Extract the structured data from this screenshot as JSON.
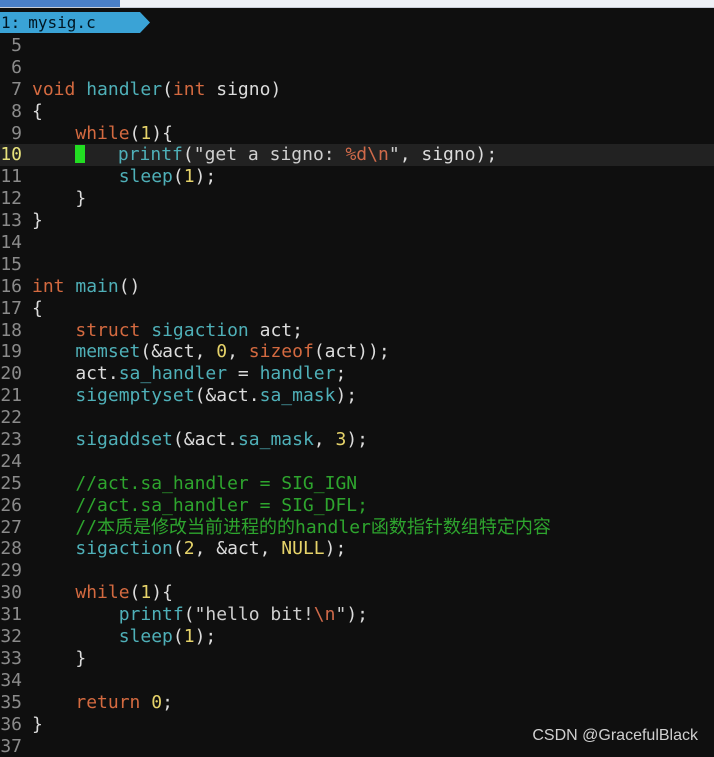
{
  "window": {
    "tab_label": "",
    "tab_close": "×"
  },
  "buffer": {
    "number": "1:",
    "filename": "mysig.c"
  },
  "lines": [
    {
      "n": "5",
      "code": ""
    },
    {
      "n": "6",
      "code": ""
    },
    {
      "n": "7",
      "code": "void handler(int signo)"
    },
    {
      "n": "8",
      "code": "{"
    },
    {
      "n": "9",
      "code": "    while(1){"
    },
    {
      "n": "10",
      "code": "        printf(\"get a signo: %d\\n\", signo);"
    },
    {
      "n": "11",
      "code": "        sleep(1);"
    },
    {
      "n": "12",
      "code": "    }"
    },
    {
      "n": "13",
      "code": "}"
    },
    {
      "n": "14",
      "code": ""
    },
    {
      "n": "15",
      "code": ""
    },
    {
      "n": "16",
      "code": "int main()"
    },
    {
      "n": "17",
      "code": "{"
    },
    {
      "n": "18",
      "code": "    struct sigaction act;"
    },
    {
      "n": "19",
      "code": "    memset(&act, 0, sizeof(act));"
    },
    {
      "n": "20",
      "code": "    act.sa_handler = handler;"
    },
    {
      "n": "21",
      "code": "    sigemptyset(&act.sa_mask);"
    },
    {
      "n": "22",
      "code": ""
    },
    {
      "n": "23",
      "code": "    sigaddset(&act.sa_mask, 3);"
    },
    {
      "n": "24",
      "code": ""
    },
    {
      "n": "25",
      "code": "    //act.sa_handler = SIG_IGN"
    },
    {
      "n": "26",
      "code": "    //act.sa_handler = SIG_DFL;"
    },
    {
      "n": "27",
      "code": "    //本质是修改当前进程的的handler函数指针数组特定内容"
    },
    {
      "n": "28",
      "code": "    sigaction(2, &act, NULL);"
    },
    {
      "n": "29",
      "code": ""
    },
    {
      "n": "30",
      "code": "    while(1){"
    },
    {
      "n": "31",
      "code": "        printf(\"hello bit!\\n\");"
    },
    {
      "n": "32",
      "code": "        sleep(1);"
    },
    {
      "n": "33",
      "code": "    }"
    },
    {
      "n": "34",
      "code": ""
    },
    {
      "n": "35",
      "code": "    return 0;"
    },
    {
      "n": "36",
      "code": "}"
    },
    {
      "n": "37",
      "code": ""
    }
  ],
  "cursor_line": "10",
  "watermark": "CSDN @GracefulBlack",
  "colors": {
    "background": "#0f0f0f",
    "keyword": "#d46a40",
    "function": "#4fb0b8",
    "number": "#e6d36a",
    "comment": "#2ea52e",
    "cursor": "#22dd22",
    "line_number": "#8b8b8b",
    "buffer_bar": "#3aa3d6"
  }
}
